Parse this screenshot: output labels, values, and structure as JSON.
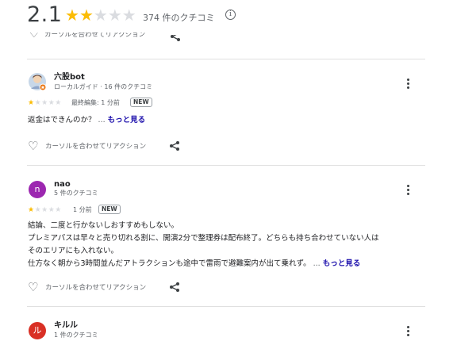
{
  "header": {
    "rating": "2.1",
    "stars_filled": 2,
    "stars_total": 5,
    "review_count": "374 件のクチコミ",
    "info_glyph": "i"
  },
  "reaction_label": "カーソルを合わせてリアクション",
  "reviews": [
    {
      "name": "六股bot",
      "subtitle": "ローカルガイド · 16 件のクチコミ",
      "stars": 1,
      "time": "最終編集: 1 分前",
      "badge": "NEW",
      "text_lines": [
        "返金はできんのか？"
      ],
      "more_ellipsis": "...",
      "more_label": "もっと見る",
      "avatar_kind": "photo"
    },
    {
      "name": "nao",
      "subtitle": "5 件のクチコミ",
      "stars": 1,
      "time": "1 分前",
      "badge": "NEW",
      "avatar_letter": "n",
      "avatar_color": "#9c27b0",
      "text_lines": [
        "結論、二度と行かないしおすすめもしない。",
        "プレミアパスは早々と売り切れる割に、開演2分で整理券は配布終了。どちらも持ち合わせていない人は",
        "そのエリアにも入れない。",
        "仕方なく朝から3時間並んだアトラクションも途中で雷雨で避難案内が出て乗れず。"
      ],
      "more_ellipsis": "...",
      "more_label": "もっと見る"
    },
    {
      "name": "キルル",
      "subtitle": "1 件のクチコミ",
      "avatar_letter": "ル",
      "avatar_color": "#d93025"
    }
  ],
  "colors": {
    "star_on": "#fbbc04",
    "star_off": "#dadce0",
    "link": "#1a0dab",
    "badge_border": "#9aa0a6"
  },
  "icons": [
    "info-icon",
    "heart-icon",
    "share-icon",
    "more-vert-icon",
    "photo-avatar-icon"
  ]
}
